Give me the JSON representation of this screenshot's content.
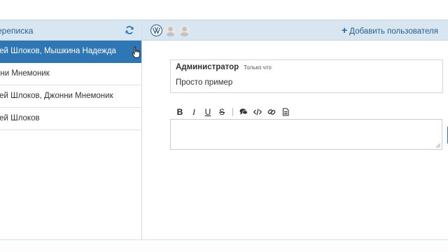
{
  "sidebar": {
    "title": "ереписка",
    "conversations": [
      {
        "label": "тей Шлоков, Мышкина Надежда",
        "active": true
      },
      {
        "label": "нни Мнемоник",
        "active": false
      },
      {
        "label": "тей Шлоков, Джонни Мнемоник",
        "active": false
      },
      {
        "label": "тей Шлоков",
        "active": false
      }
    ]
  },
  "header": {
    "add_user_label": "Добавить пользователя"
  },
  "message": {
    "author": "Администратор",
    "time": "Только что",
    "text": "Просто пример"
  },
  "toolbar": {
    "bold": "B",
    "italic": "I",
    "underline": "U",
    "strike": "S"
  },
  "colors": {
    "accent": "#2f76b5",
    "header_bg": "#d7e6f1",
    "link": "#2a5f8c"
  }
}
